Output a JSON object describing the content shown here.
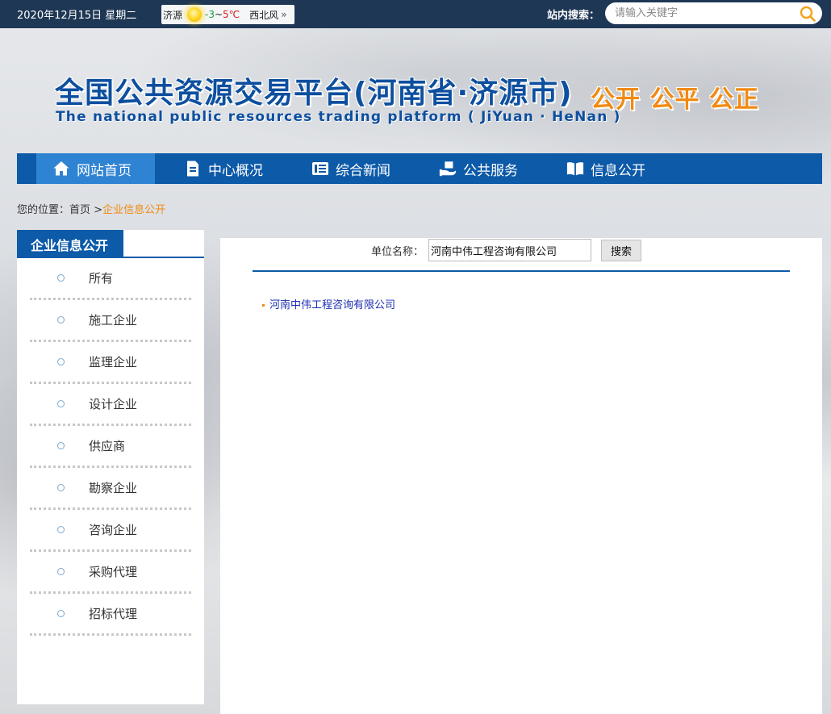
{
  "topbar": {
    "date": "2020年12月15日 星期二",
    "weather": {
      "city": "济源",
      "temp_low": "-3",
      "temp_sep": "~",
      "temp_high": "5℃",
      "wind": "西北风",
      "more": "»"
    },
    "search_label": "站内搜索：",
    "search_placeholder": "请输入关键字"
  },
  "banner": {
    "title": "全国公共资源交易平台(河南省·济源市)",
    "slogan": "公开 公平 公正",
    "subtitle": "The national public resources trading platform ( JiYuan · HeNan )"
  },
  "nav": {
    "items": [
      {
        "label": "网站首页",
        "icon": "home-icon",
        "active": true
      },
      {
        "label": "中心概况",
        "icon": "document-icon"
      },
      {
        "label": "综合新闻",
        "icon": "news-icon"
      },
      {
        "label": "公共服务",
        "icon": "service-icon"
      },
      {
        "label": "信息公开",
        "icon": "book-icon"
      }
    ]
  },
  "breadcrumb": {
    "prefix": "您的位置：",
    "home": "首页",
    "sep": " >",
    "current": "企业信息公开"
  },
  "sidebar": {
    "title": "企业信息公开",
    "items": [
      {
        "label": "所有"
      },
      {
        "label": "施工企业"
      },
      {
        "label": "监理企业"
      },
      {
        "label": "设计企业"
      },
      {
        "label": "供应商"
      },
      {
        "label": "勘察企业"
      },
      {
        "label": "咨询企业"
      },
      {
        "label": "采购代理"
      },
      {
        "label": "招标代理"
      }
    ]
  },
  "filter": {
    "label": "单位名称：",
    "value": "河南中伟工程咨询有限公司",
    "button": "搜索"
  },
  "results": [
    {
      "name": "河南中伟工程咨询有限公司"
    }
  ],
  "colors": {
    "nav_bg": "#0c5aa8",
    "nav_active": "#2f83d3",
    "accent_orange": "#f08a12",
    "topbar_bg": "#1e3754",
    "link": "#1d2fb0"
  }
}
